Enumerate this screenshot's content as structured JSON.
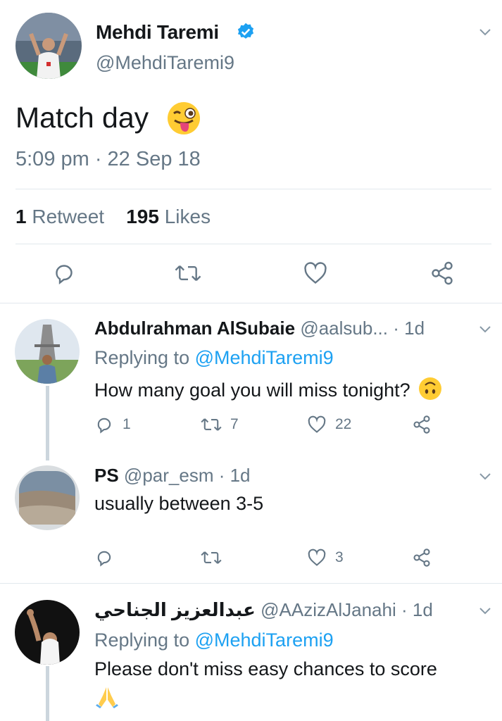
{
  "main_tweet": {
    "name": "Mehdi Taremi",
    "handle": "@MehdiTaremi9",
    "text": "Match day",
    "emoji": "winking-face-with-tongue",
    "time": "5:09 pm · 22 Sep 18",
    "retweets_count": "1",
    "retweets_label": "Retweet",
    "likes_count": "195",
    "likes_label": "Likes"
  },
  "replies": [
    {
      "name": "Abdulrahman AlSubaie",
      "handle": "@aalsub...",
      "age": "· 1d",
      "replying_label": "Replying to",
      "replying_to": "@MehdiTaremi9",
      "text": "How many goal you will miss tonight?",
      "emoji": "upside-down-face",
      "replies": "1",
      "retweets": "7",
      "likes": "22"
    },
    {
      "name": "PS",
      "handle": "@par_esm",
      "age": "· 1d",
      "text": "usually between 3-5",
      "likes": "3"
    },
    {
      "name": "عبدالعزيز الجناحي",
      "handle": "@AAzizAlJanahi",
      "age": "· 1d",
      "replying_label": "Replying to",
      "replying_to": "@MehdiTaremi9",
      "text": "Please don't miss easy chances to score",
      "emoji": "folded-hands"
    }
  ],
  "colors": {
    "text": "#14171a",
    "secondary": "#657786",
    "link": "#1da1f2",
    "divider": "#e1e8ed",
    "thread_line": "#ccd6dd"
  }
}
